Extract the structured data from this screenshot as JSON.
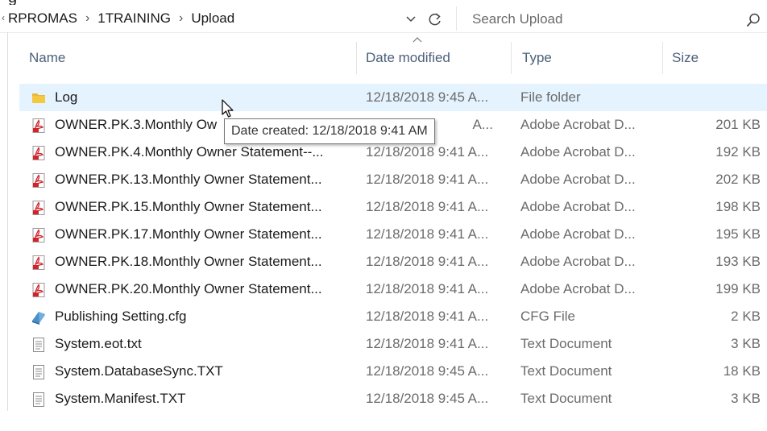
{
  "header_partial": "g",
  "breadcrumb": {
    "items": [
      "RPROMAS",
      "1TRAINING",
      "Upload"
    ],
    "separator": "›"
  },
  "search": {
    "placeholder": "Search Upload"
  },
  "columns": {
    "name": "Name",
    "date": "Date modified",
    "type": "Type",
    "size": "Size"
  },
  "files": [
    {
      "name": "Log",
      "date": "12/18/2018 9:45 A...",
      "type": "File folder",
      "size": "",
      "icon": "folder-icon"
    },
    {
      "name": "OWNER.PK.3.Monthly Ow",
      "date": "A...",
      "type": "Adobe Acrobat D...",
      "size": "201 KB",
      "icon": "pdf-icon"
    },
    {
      "name": "OWNER.PK.4.Monthly Owner Statement--...",
      "date": "12/18/2018 9:41 A...",
      "type": "Adobe Acrobat D...",
      "size": "192 KB",
      "icon": "pdf-icon"
    },
    {
      "name": "OWNER.PK.13.Monthly Owner Statement...",
      "date": "12/18/2018 9:41 A...",
      "type": "Adobe Acrobat D...",
      "size": "202 KB",
      "icon": "pdf-icon"
    },
    {
      "name": "OWNER.PK.15.Monthly Owner Statement...",
      "date": "12/18/2018 9:41 A...",
      "type": "Adobe Acrobat D...",
      "size": "198 KB",
      "icon": "pdf-icon"
    },
    {
      "name": "OWNER.PK.17.Monthly Owner Statement...",
      "date": "12/18/2018 9:41 A...",
      "type": "Adobe Acrobat D...",
      "size": "195 KB",
      "icon": "pdf-icon"
    },
    {
      "name": "OWNER.PK.18.Monthly Owner Statement...",
      "date": "12/18/2018 9:41 A...",
      "type": "Adobe Acrobat D...",
      "size": "193 KB",
      "icon": "pdf-icon"
    },
    {
      "name": "OWNER.PK.20.Monthly Owner Statement...",
      "date": "12/18/2018 9:41 A...",
      "type": "Adobe Acrobat D...",
      "size": "199 KB",
      "icon": "pdf-icon"
    },
    {
      "name": "Publishing Setting.cfg",
      "date": "12/18/2018 9:41 A...",
      "type": "CFG File",
      "size": "2 KB",
      "icon": "config-file-icon"
    },
    {
      "name": "System.eot.txt",
      "date": "12/18/2018 9:41 A...",
      "type": "Text Document",
      "size": "3 KB",
      "icon": "text-file-icon"
    },
    {
      "name": "System.DatabaseSync.TXT",
      "date": "12/18/2018 9:45 A...",
      "type": "Text Document",
      "size": "18 KB",
      "icon": "text-file-icon"
    },
    {
      "name": "System.Manifest.TXT",
      "date": "12/18/2018 9:45 A...",
      "type": "Text Document",
      "size": "3 KB",
      "icon": "text-file-icon"
    }
  ],
  "hovered_index": 0,
  "tooltip": "Date created: 12/18/2018 9:41 AM",
  "colors": {
    "hover_row": "#e5f3ff",
    "header_text": "#4c607a",
    "secondary_text": "#6b6b6b",
    "pdf_red": "#d2232a",
    "folder_yellow": "#e8b83a"
  }
}
